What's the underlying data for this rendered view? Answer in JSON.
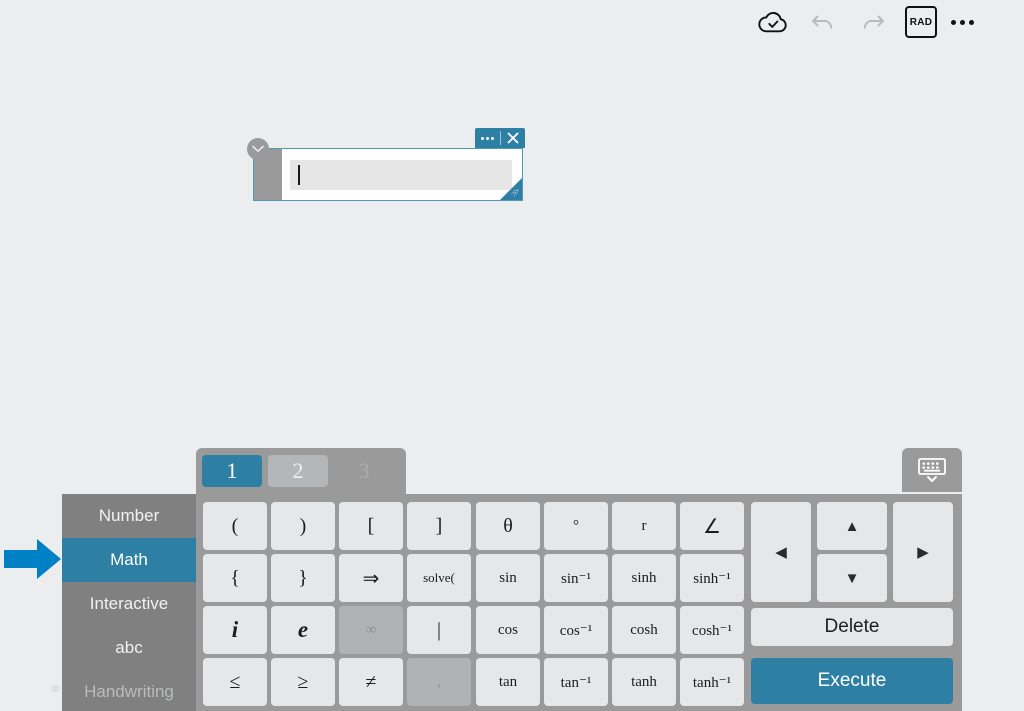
{
  "toolbar": {
    "save_status_icon": "cloud-check-icon",
    "undo_icon": "undo-icon",
    "redo_icon": "redo-icon",
    "angle_mode_label": "RAD",
    "overflow_icon": "more-options-icon"
  },
  "math_box": {
    "more_icon": "more-options-icon",
    "close_icon": "close-icon",
    "collapse_icon": "chevron-down-icon",
    "resize_icon": "resize-handle-icon",
    "input_value": "",
    "input_placeholder": ""
  },
  "keyboard": {
    "page_tabs": [
      {
        "label": "1",
        "state": "active"
      },
      {
        "label": "2",
        "state": "idle"
      },
      {
        "label": "3",
        "state": "empty"
      }
    ],
    "hide_keyboard_icon": "keyboard-hide-icon",
    "categories": [
      {
        "label": "Number",
        "state": "normal"
      },
      {
        "label": "Math",
        "state": "active"
      },
      {
        "label": "Interactive",
        "state": "normal"
      },
      {
        "label": "abc",
        "state": "normal"
      },
      {
        "label": "Handwriting",
        "state": "disabled"
      }
    ],
    "keys_left": [
      {
        "label": "(",
        "style": "normal",
        "state": "enabled"
      },
      {
        "label": ")",
        "style": "normal",
        "state": "enabled"
      },
      {
        "label": "[",
        "style": "normal",
        "state": "enabled"
      },
      {
        "label": "]",
        "style": "normal",
        "state": "enabled"
      },
      {
        "label": "{",
        "style": "normal",
        "state": "enabled"
      },
      {
        "label": "}",
        "style": "normal",
        "state": "enabled"
      },
      {
        "label": "⇒",
        "style": "normal",
        "state": "enabled"
      },
      {
        "label": "solve(",
        "style": "tiny",
        "state": "enabled"
      },
      {
        "label": "i",
        "style": "ital",
        "state": "enabled"
      },
      {
        "label": "e",
        "style": "ital",
        "state": "enabled"
      },
      {
        "label": "∞",
        "style": "small",
        "state": "disabled"
      },
      {
        "label": "|",
        "style": "normal",
        "state": "enabled"
      },
      {
        "label": "≤",
        "style": "normal",
        "state": "enabled"
      },
      {
        "label": "≥",
        "style": "normal",
        "state": "enabled"
      },
      {
        "label": "≠",
        "style": "normal",
        "state": "enabled"
      },
      {
        "label": ",",
        "style": "small",
        "state": "disabled"
      }
    ],
    "keys_mid": [
      {
        "label": "θ",
        "style": "normal",
        "state": "enabled"
      },
      {
        "label": "°",
        "style": "small",
        "state": "enabled"
      },
      {
        "label": "r",
        "style": "small",
        "state": "enabled"
      },
      {
        "label": "∠",
        "style": "normal",
        "state": "enabled"
      },
      {
        "label": "sin",
        "style": "small",
        "state": "enabled"
      },
      {
        "label": "sin⁻¹",
        "style": "small",
        "state": "enabled"
      },
      {
        "label": "sinh",
        "style": "small",
        "state": "enabled"
      },
      {
        "label": "sinh⁻¹",
        "style": "small",
        "state": "enabled"
      },
      {
        "label": "cos",
        "style": "small",
        "state": "enabled"
      },
      {
        "label": "cos⁻¹",
        "style": "small",
        "state": "enabled"
      },
      {
        "label": "cosh",
        "style": "small",
        "state": "enabled"
      },
      {
        "label": "cosh⁻¹",
        "style": "small",
        "state": "enabled"
      },
      {
        "label": "tan",
        "style": "small",
        "state": "enabled"
      },
      {
        "label": "tan⁻¹",
        "style": "small",
        "state": "enabled"
      },
      {
        "label": "tanh",
        "style": "small",
        "state": "enabled"
      },
      {
        "label": "tanh⁻¹",
        "style": "small",
        "state": "enabled"
      }
    ],
    "nav_keys": {
      "left_label": "◀",
      "up_label": "▲",
      "down_label": "▼",
      "right_label": "▶"
    },
    "delete_label": "Delete",
    "execute_label": "Execute"
  },
  "annotation": {
    "arrow_icon": "right-arrow-annotation-icon",
    "arrow_color": "#0081c6"
  },
  "colors": {
    "accent": "#2d7fa3",
    "page_background": "#ecedee",
    "panel_gray": "#9a9a9a",
    "category_gray": "#808080",
    "key_face": "#e6e7e8",
    "key_disabled": "#b0b2b3"
  }
}
